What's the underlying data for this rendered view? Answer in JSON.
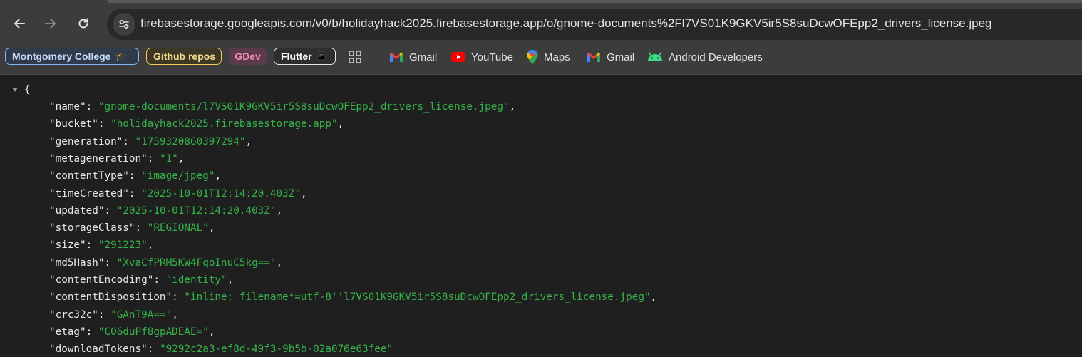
{
  "address_bar": {
    "url": "firebasestorage.googleapis.com/v0/b/holidayhack2025.firebasestorage.app/o/gnome-documents%2Fl7VS01K9GKV5ir5S8suDcwOFEpp2_drivers_license.jpeg"
  },
  "bookmarks": [
    {
      "label": "Montgomery College",
      "emoji": "🎓",
      "color": "#8ab4f8",
      "text_color": "#c5daf7"
    },
    {
      "label": "Github repos",
      "color": "#f2c94c",
      "text_color": "#f6dd92"
    },
    {
      "label": "GDev",
      "color": "#5b3a4a",
      "text_color": "#f08db5"
    },
    {
      "label": "Flutter",
      "emoji": "📱",
      "color": "#e8e8e8",
      "text_color": "#ffffff"
    },
    {
      "label": "Gmail",
      "icon": "gmail-icon"
    },
    {
      "label": "YouTube",
      "icon": "youtube-icon"
    },
    {
      "label": "Maps",
      "icon": "maps-icon"
    },
    {
      "label": "Gmail",
      "icon": "gmail-icon"
    },
    {
      "label": "Android Developers",
      "icon": "android-icon"
    }
  ],
  "json_view": {
    "open_brace": "{",
    "fields": [
      {
        "key": "name",
        "value": "gnome-documents/l7VS01K9GKV5ir5S8suDcwOFEpp2_drivers_license.jpeg"
      },
      {
        "key": "bucket",
        "value": "holidayhack2025.firebasestorage.app"
      },
      {
        "key": "generation",
        "value": "1759320860397294"
      },
      {
        "key": "metageneration",
        "value": "1"
      },
      {
        "key": "contentType",
        "value": "image/jpeg"
      },
      {
        "key": "timeCreated",
        "value": "2025-10-01T12:14:20.403Z"
      },
      {
        "key": "updated",
        "value": "2025-10-01T12:14:20.403Z"
      },
      {
        "key": "storageClass",
        "value": "REGIONAL"
      },
      {
        "key": "size",
        "value": "291223"
      },
      {
        "key": "md5Hash",
        "value": "XvaCfPRM5KW4FqoInuC5kg=="
      },
      {
        "key": "contentEncoding",
        "value": "identity"
      },
      {
        "key": "contentDisposition",
        "value": "inline; filename*=utf-8''l7VS01K9GKV5ir5S8suDcwOFEpp2_drivers_license.jpeg"
      },
      {
        "key": "crc32c",
        "value": "GAnT9A=="
      },
      {
        "key": "etag",
        "value": "CO6duPf8gpADEAE="
      },
      {
        "key": "downloadTokens",
        "value": "9292c2a3-ef8d-49f3-9b5b-02a076e63fee"
      }
    ]
  }
}
